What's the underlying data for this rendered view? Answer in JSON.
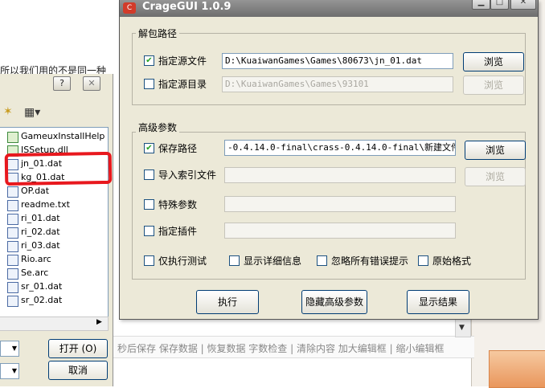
{
  "background": {
    "text_fragment": "所以我们用的不是同一种",
    "toolbar_text": "秒后保存 保存数据 | 恢复数据   字数检查 | 清除内容   加大编辑框 | 缩小编辑框"
  },
  "file_dialog": {
    "help_label": "?",
    "close_label": "✕",
    "files": [
      "GameuxInstallHelp",
      "ISSetup.dll",
      "jn_01.dat",
      "kg_01.dat",
      "OP.dat",
      "readme.txt",
      "ri_01.dat",
      "ri_02.dat",
      "ri_03.dat",
      "Rio.arc",
      "Se.arc",
      "sr_01.dat",
      "sr_02.dat"
    ],
    "open_label": "打开 (O)",
    "cancel_label": "取消"
  },
  "crage": {
    "title": "CrageGUI 1.0.9",
    "group_unpack": "解包路径",
    "source_file_label": "指定源文件",
    "source_file_checked": true,
    "source_file_value": "D:\\KuaiwanGames\\Games\\80673\\jn_01.dat",
    "browse_label": "浏览",
    "source_dir_label": "指定源目录",
    "source_dir_checked": false,
    "source_dir_value": "D:\\KuaiwanGames\\Games\\93101",
    "group_advanced": "高级参数",
    "save_path_label": "保存路径",
    "save_path_checked": true,
    "save_path_value": "-0.4.14.0-final\\crass-0.4.14.0-final\\新建文件夹",
    "import_index_label": "导入索引文件",
    "special_params_label": "特殊参数",
    "plugin_label": "指定插件",
    "opt_test_only": "仅执行测试",
    "opt_verbose": "显示详细信息",
    "opt_ignore_errors": "忽略所有错误提示",
    "opt_raw_format": "原始格式",
    "execute_label": "执行",
    "hide_advanced_label": "隐藏高级参数",
    "show_result_label": "显示结果"
  }
}
